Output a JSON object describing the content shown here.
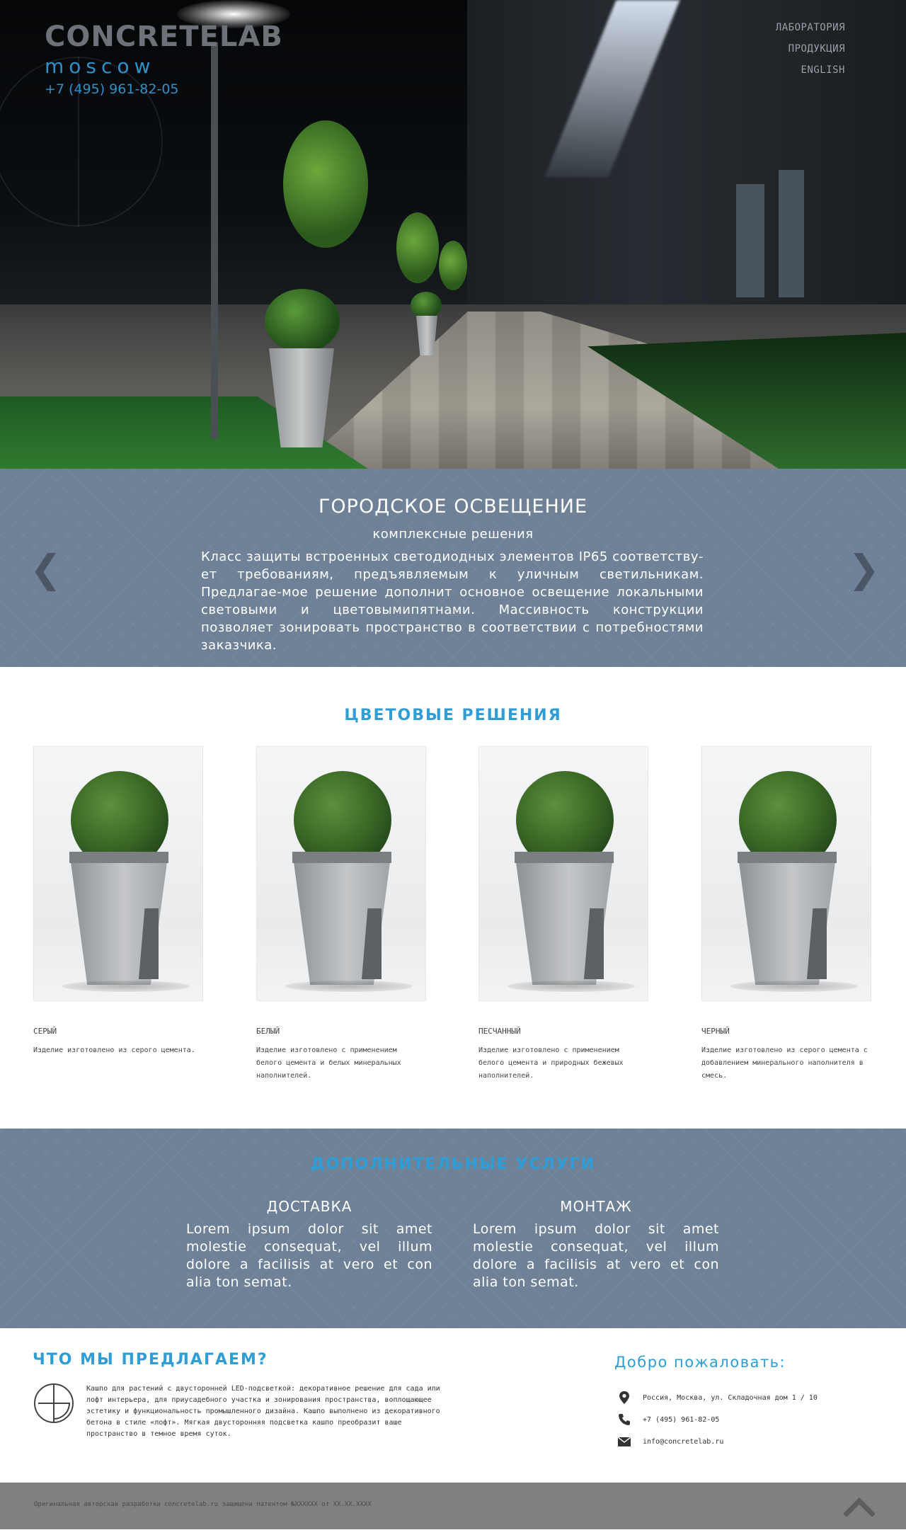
{
  "header": {
    "logo_title": "CONCRETELAB",
    "logo_city": "moscow",
    "phone": "+7 (495) 961-82-05",
    "nav": [
      "ЛАБОРАТОРИЯ",
      "ПРОДУКЦИЯ",
      "ENGLISH"
    ]
  },
  "slider": {
    "title": "ГОРОДСКОЕ ОСВЕЩЕНИЕ",
    "subtitle": "комплексные решения",
    "text": "Класс защиты встроенных светодиодных элементов IP65 соответству-ет требованиям, предъявляемым к уличным светильникам. Предлагае-мое решение дополнит основное освещение локальными световыми и цветовымипятнами. Массивность конструкции позволяет зонировать пространство в соответствии с потребностями заказчика.",
    "prev_icon": "chevron-left-icon",
    "next_icon": "chevron-right-icon"
  },
  "colors_section": {
    "title": "ЦВЕТОВЫЕ РЕШЕНИЯ",
    "items": [
      {
        "name": "СЕРЫЙ",
        "desc": "Изделие изготовлено из серого цемента."
      },
      {
        "name": "БЕЛЫЙ",
        "desc": "Изделие изготовлено с применением белого цемента и белых минеральных наполнителей."
      },
      {
        "name": "ПЕСЧАННЫЙ",
        "desc": "Изделие изготовлено с применением белого цемента и природных бежевых наполнителей."
      },
      {
        "name": "ЧЕРНЫЙ",
        "desc": "Изделие изготовлено из серого цемента с добавлением минерального наполнителя в смесь."
      }
    ]
  },
  "services": {
    "title": "ДОПОЛНИТЕЛЬНЫЕ УСЛУГИ",
    "items": [
      {
        "title": "ДОСТАВКА",
        "text": "Lorem ipsum dolor sit amet molestie consequat, vel illum dolore a facilisis at vero et con alia ton semat."
      },
      {
        "title": "МОНТАЖ",
        "text": "Lorem ipsum dolor sit amet molestie consequat, vel illum dolore a facilisis at vero et con alia ton semat."
      }
    ]
  },
  "info": {
    "offer_title": "ЧТО МЫ ПРЕДЛАГАЕМ?",
    "offer_text": "Кашпо для растений с двусторонней LED-подсветкой: декоративное решение для сада или лофт интерьера, для приусадебного участка и зонирования пространства, воплощающее эстетику и функциональность промышленного дизайна. Кашпо выполнено из декоративного бетона в стиле «лофт». Мягкая двусторонняя подсветка кашпо преобразит ваше пространство в темное время суток.",
    "welcome_title": "Добро пожаловать:",
    "address": "Россия, Москва, ул. Складочная дом 1 / 10",
    "phone": "+7 (495) 961-82-05",
    "email": "info@concretelab.ru"
  },
  "footer": {
    "copyright": "Оригинальная авторская разработка concretelab.ru защищена патентом №XXXXXX от XX.XX.XXXX"
  },
  "colors": {
    "accent": "#2f9ed6",
    "band": "#6e8196",
    "footer": "#808080"
  }
}
